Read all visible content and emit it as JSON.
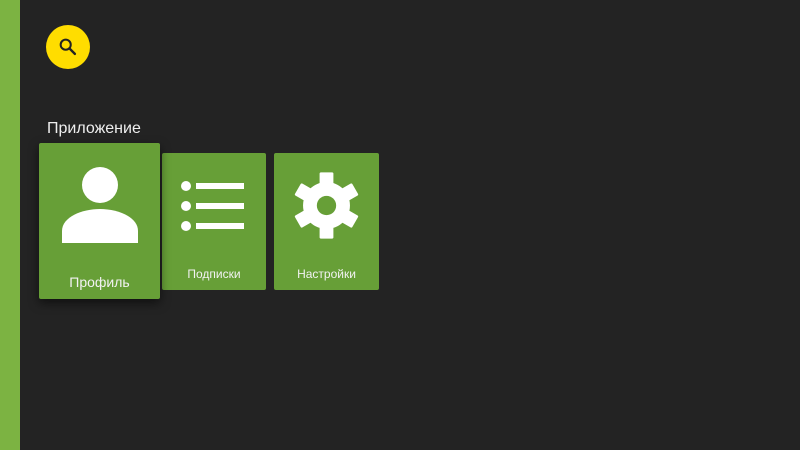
{
  "theme": {
    "background": "#232323",
    "rail": "#7cb342",
    "tile": "#679f37",
    "search_button": "#ffdd00",
    "text": "#eeeeee"
  },
  "search": {
    "icon": "search-icon"
  },
  "section": {
    "title": "Приложение"
  },
  "tiles": [
    {
      "id": "profile",
      "label": "Профиль",
      "icon": "person-icon",
      "focused": true
    },
    {
      "id": "subscriptions",
      "label": "Подписки",
      "icon": "list-icon",
      "focused": false
    },
    {
      "id": "settings",
      "label": "Настройки",
      "icon": "gear-icon",
      "focused": false
    }
  ]
}
